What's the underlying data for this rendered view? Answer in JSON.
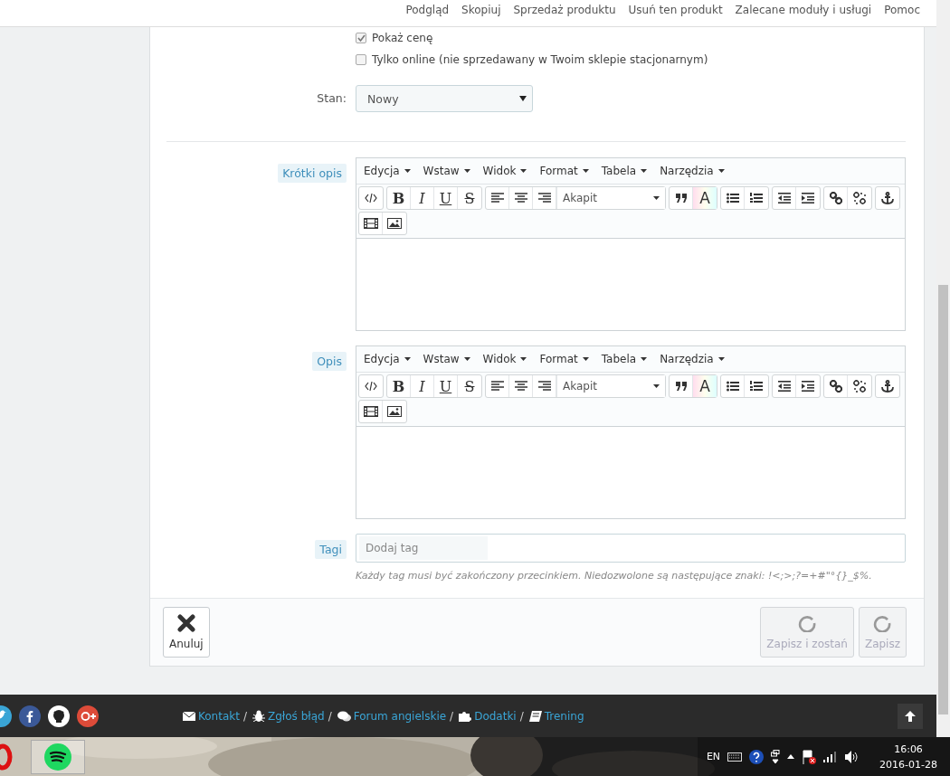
{
  "header": {
    "links": [
      "Podgląd",
      "Skopiuj",
      "Sprzedaż produktu",
      "Usuń ten produkt",
      "Zalecane moduły i usługi",
      "Pomoc"
    ]
  },
  "panel": {
    "checkboxes": [
      {
        "label": "Pokaż cenę",
        "checked": true
      },
      {
        "label": "Tylko online (nie sprzedawany w Twoim sklepie stacjonarnym)",
        "checked": false
      }
    ],
    "condition": {
      "label": "Stan:",
      "value": "Nowy"
    },
    "editors": [
      {
        "label": "Krótki opis",
        "menus": [
          "Edycja",
          "Wstaw",
          "Widok",
          "Format",
          "Tabela",
          "Narzędzia"
        ],
        "format_buttons": [
          "B",
          "I",
          "U",
          "S"
        ],
        "block_format": "Akapit",
        "color_button": "A"
      },
      {
        "label": "Opis",
        "menus": [
          "Edycja",
          "Wstaw",
          "Widok",
          "Format",
          "Tabela",
          "Narzędzia"
        ],
        "format_buttons": [
          "B",
          "I",
          "U",
          "S"
        ],
        "block_format": "Akapit",
        "color_button": "A"
      }
    ],
    "tags": {
      "label": "Tagi",
      "placeholder": "Dodaj tag",
      "hint": "Każdy tag musi być zakończony przecinkiem. Niedozwolone są następujące znaki: !<;>;?=+#\"°{}_$%."
    },
    "buttons": [
      {
        "label": "Anuluj",
        "kind": "cancel",
        "disabled": false
      },
      {
        "label": "Zapisz i zostań",
        "kind": "save",
        "disabled": true
      },
      {
        "label": "Zapisz",
        "kind": "save",
        "disabled": true
      }
    ]
  },
  "footer": {
    "links": [
      {
        "label": "Kontakt",
        "separator": "/"
      },
      {
        "label": "Zgłoś błąd",
        "separator": "/"
      },
      {
        "label": "Forum angielskie",
        "separator": "/"
      },
      {
        "label": "Dodatki",
        "separator": "/"
      },
      {
        "label": "Trening"
      }
    ]
  },
  "taskbar": {
    "language": "EN",
    "time": "16:06",
    "date": "2016-01-28"
  }
}
